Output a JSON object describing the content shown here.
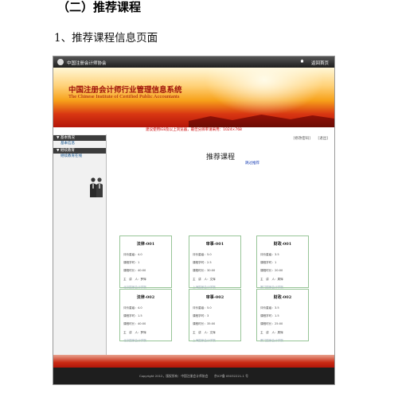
{
  "document": {
    "heading": "（二）推荐课程",
    "subheading": "1、推荐课程信息页面"
  },
  "app": {
    "org_name": "中国注册会计师协会",
    "back_link": "返回首页",
    "title_cn": "中国注册会计师行业管理信息系统",
    "title_en": "The Chinese Institute of Certified Public Accountants",
    "notice": "建议使用IE8及以上浏览器，最佳分辨率请采用：1024×768"
  },
  "sidebar": {
    "sections": [
      {
        "label": "基本情况",
        "items": [
          {
            "label": "基本信息"
          }
        ]
      },
      {
        "label": "继续教育",
        "items": [
          {
            "label": "继续教育在线"
          }
        ]
      }
    ]
  },
  "content": {
    "links": [
      {
        "label": "[修改密码]"
      },
      {
        "label": "[退出]"
      }
    ],
    "page_title": "推荐课程",
    "skip_label": "跳过推荐",
    "courses": [
      {
        "title": "法律-001",
        "rating": "评价星级：4.0",
        "credit": "课程学时：1",
        "duration": "课程时长：40:00",
        "lecturer": "主　讲　人：罗辉",
        "org": "北京国家会计学院"
      },
      {
        "title": "审事-001",
        "rating": "评价星级：5.0",
        "credit": "课程学时：2.5",
        "duration": "课程时长：30:00",
        "lecturer": "主　讲　人：文辉",
        "org": "上海国家会计学院"
      },
      {
        "title": "财政-001",
        "rating": "评价星级：3.5",
        "credit": "课程学时：1",
        "duration": "课程时长：20:00",
        "lecturer": "主　讲　人：周辉",
        "org": "厦门国家会计学院"
      },
      {
        "title": "法律-002",
        "rating": "评价星级：4.0",
        "credit": "课程学时：1.5",
        "duration": "课程时长：40:00",
        "lecturer": "主　讲　人：罗辉",
        "org": "北京国家会计学院"
      },
      {
        "title": "审事-002",
        "rating": "评价星级：5.0",
        "credit": "课程学时：3",
        "duration": "课程时长：35:00",
        "lecturer": "主　讲　人：文辉",
        "org": "上海国家会计学院"
      },
      {
        "title": "财政-002",
        "rating": "评价星级：3.5",
        "credit": "课程学时：1.5",
        "duration": "课程时长：25:00",
        "lecturer": "主　讲　人：周辉",
        "org": "厦门国家会计学院"
      }
    ]
  },
  "footer": {
    "text": "Copyright 2012，版权所有：中国注册会计师协会　　京ICP备 05032221-1 号"
  },
  "colors": {
    "accent_red": "#c92a14",
    "card_border": "#97c597",
    "link_blue": "#1a3fb5"
  },
  "icons": {
    "logo": "cicpa-logo-icon",
    "home": "home-icon",
    "people": "people-illustration"
  }
}
